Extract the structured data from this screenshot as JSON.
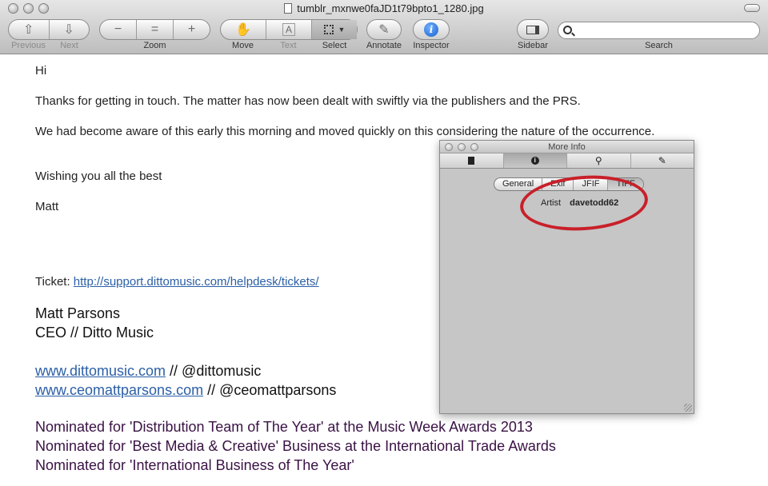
{
  "window": {
    "title": "tumblr_mxnwe0faJD1t79bpto1_1280.jpg"
  },
  "toolbar": {
    "previous_label": "Previous",
    "next_label": "Next",
    "zoom_label": "Zoom",
    "move_label": "Move",
    "text_label": "Text",
    "select_label": "Select",
    "annotate_label": "Annotate",
    "inspector_label": "Inspector",
    "sidebar_label": "Sidebar",
    "search_label": "Search",
    "zoom_out_glyph": "−",
    "zoom_fit_glyph": "=",
    "zoom_in_glyph": "+",
    "text_glyph": "A",
    "info_glyph": "i"
  },
  "email": {
    "greeting": "Hi",
    "line1": "Thanks for getting in touch. The matter has now been dealt with swiftly via the publishers and the PRS.",
    "line2": "We had become aware of this early this morning and moved quickly on this considering the nature of the occurrence.",
    "closing": "Wishing you all the best",
    "sender": "Matt",
    "ticket_label": "Ticket:",
    "ticket_url": "http://support.dittomusic.com/helpdesk/tickets/",
    "sig_name": "Matt Parsons",
    "sig_title": "CEO // Ditto Music",
    "site1": "www.dittomusic.com",
    "site1_suffix": " // @dittomusic",
    "site2": "www.ceomattparsons.com",
    "site2_suffix": " // @ceomattparsons",
    "nominations": [
      "Nominated for 'Distribution Team of The Year' at the Music Week Awards 2013",
      "Nominated for 'Best Media & Creative' Business at the International Trade Awards",
      "Nominated for 'International Business of The Year'"
    ]
  },
  "more_info": {
    "title": "More Info",
    "tabs": [
      "document-icon",
      "info-icon",
      "search-icon",
      "pencil-icon"
    ],
    "subtabs": [
      "General",
      "Exif",
      "JFIF",
      "TIFF"
    ],
    "selected_subtab": "TIFF",
    "artist_key": "Artist",
    "artist_value": "davetodd62",
    "highlight_color": "#c8202a"
  },
  "colors": {
    "link": "#2b5fa6",
    "nomination": "#3a1245"
  }
}
